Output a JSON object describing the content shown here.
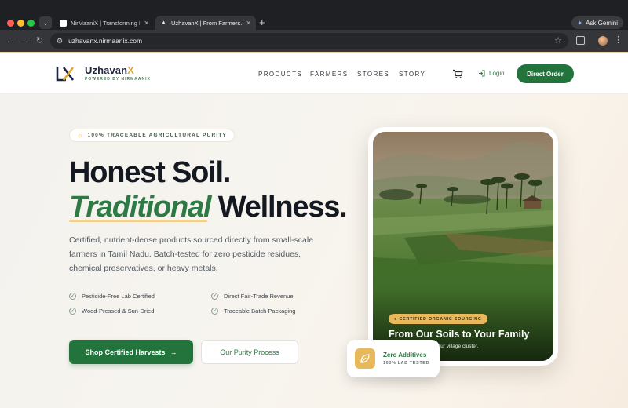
{
  "browser": {
    "tabs": [
      {
        "title": "NirMaaniX | Transforming Lo",
        "active": false
      },
      {
        "title": "UzhavanX | From Farmers. Fi",
        "active": true
      }
    ],
    "gemini_label": "Ask Gemini",
    "url": "uzhavanx.nirmaanix.com",
    "icons": {
      "back": "arrow-left-icon",
      "forward": "arrow-right-icon",
      "reload": "reload-icon",
      "bookmark": "star-icon",
      "extensions": "puzzle-icon",
      "menu": "kebab-menu-icon"
    }
  },
  "header": {
    "logo_name_main": "Uzhavan",
    "logo_name_accent": "X",
    "logo_sub": "POWERED BY NIRMAANIX",
    "nav": [
      "PRODUCTS",
      "FARMERS",
      "STORES",
      "STORY"
    ],
    "login_label": "Login",
    "cta_label": "Direct Order"
  },
  "hero": {
    "badge": "100% TRACEABLE AGRICULTURAL PURITY",
    "heading_line1": "Honest Soil.",
    "heading_em": "Traditional",
    "heading_rest": " Wellness.",
    "description": "Certified, nutrient-dense products sourced directly from small-scale farmers in Tamil Nadu. Batch-tested for zero pesticide residues, chemical preservatives, or heavy metals.",
    "features": [
      "Pesticide-Free Lab Certified",
      "Direct Fair-Trade Revenue",
      "Wood-Pressed & Sun-Dried",
      "Traceable Batch Packaging"
    ],
    "primary_cta": "Shop Certified Harvests",
    "secondary_cta": "Our Purity Process"
  },
  "card": {
    "pill": "CERTIFIED ORGANIC SOURCING",
    "title": "From Our Soils to Your Family",
    "subtitle": "ps and biodiversity in our village cluster."
  },
  "float_card": {
    "title": "Zero Additives",
    "subtitle": "100% LAB TESTED"
  },
  "colors": {
    "brand_green": "#23733c",
    "accent_gold": "#e8b85a",
    "navy": "#1d2540"
  }
}
